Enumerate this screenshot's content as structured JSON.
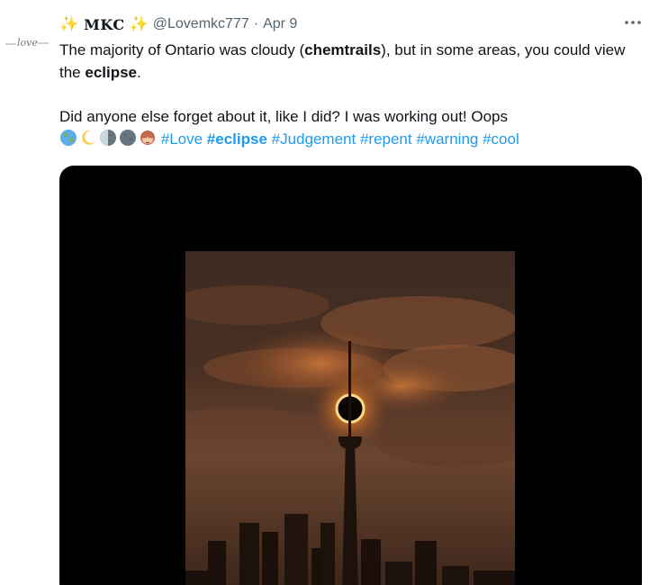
{
  "tweet": {
    "display_name": "MKC",
    "sparkle_left": "✨",
    "sparkle_right": "✨",
    "handle": "@Lovemkc777",
    "separator": "·",
    "date": "Apr 9",
    "avatar_text": "love",
    "text": {
      "line1_a": "The majority of Ontario was cloudy (",
      "line1_bold": "chemtrails",
      "line1_b": "), but in some areas, you could view the ",
      "line1_bold2": "eclipse",
      "line1_c": ".",
      "line2": "Did anyone else forget about it, like I did? I was working out! Oops"
    },
    "emojis": [
      "globe-emoji",
      "crescent-moon-emoji",
      "last-quarter-moon-emoji",
      "new-moon-emoji",
      "see-no-evil-monkey-emoji"
    ],
    "hashtags": [
      {
        "label": "#Love",
        "bold": false
      },
      {
        "label": "#eclipse",
        "bold": true
      },
      {
        "label": "#Judgement",
        "bold": false
      },
      {
        "label": "#repent",
        "bold": false
      },
      {
        "label": "#warning",
        "bold": false
      },
      {
        "label": "#cool",
        "bold": false
      }
    ],
    "more_icon": "more-horizontal-icon",
    "media": {
      "type": "image",
      "subject": "solar-eclipse-over-cn-tower"
    }
  },
  "colors": {
    "text": "#0f1419",
    "secondary": "#536471",
    "link": "#1d9bf0",
    "sparkle": "#f4b400",
    "media_bg": "#000000"
  }
}
